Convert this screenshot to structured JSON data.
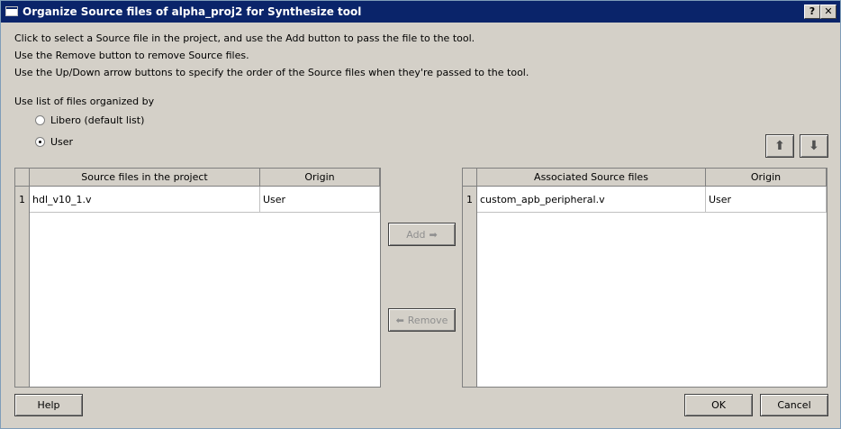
{
  "window": {
    "title": "Organize Source files of alpha_proj2 for Synthesize tool",
    "help_glyph": "?",
    "close_glyph": "✕"
  },
  "instructions": [
    "Click to select a Source file in the project, and use the Add button to pass the file to the tool.",
    "Use the Remove button to remove Source files.",
    "Use the Up/Down arrow buttons to specify the order of the Source files when they're passed to the tool."
  ],
  "organize": {
    "label": "Use list of files organized by",
    "options": [
      {
        "label": "Libero (default list)",
        "checked": false
      },
      {
        "label": "User",
        "checked": true
      }
    ]
  },
  "source_table": {
    "headers": {
      "file": "Source files in the project",
      "origin": "Origin"
    },
    "rows": [
      {
        "num": "1",
        "file": "hdl_v10_1.v",
        "origin": "User"
      }
    ]
  },
  "associated_table": {
    "headers": {
      "file": "Associated Source files",
      "origin": "Origin"
    },
    "rows": [
      {
        "num": "1",
        "file": "custom_apb_peripheral.v",
        "origin": "User"
      }
    ]
  },
  "buttons": {
    "add": "Add",
    "remove": "Remove",
    "help": "Help",
    "ok": "OK",
    "cancel": "Cancel",
    "add_arrow": "➡",
    "remove_arrow": "⬅",
    "up_arrow": "⬆",
    "down_arrow": "⬇"
  },
  "colors": {
    "titlebar": "#0a246a",
    "dialog_bg": "#d4d0c8",
    "disabled_text": "#8f8f8f"
  }
}
